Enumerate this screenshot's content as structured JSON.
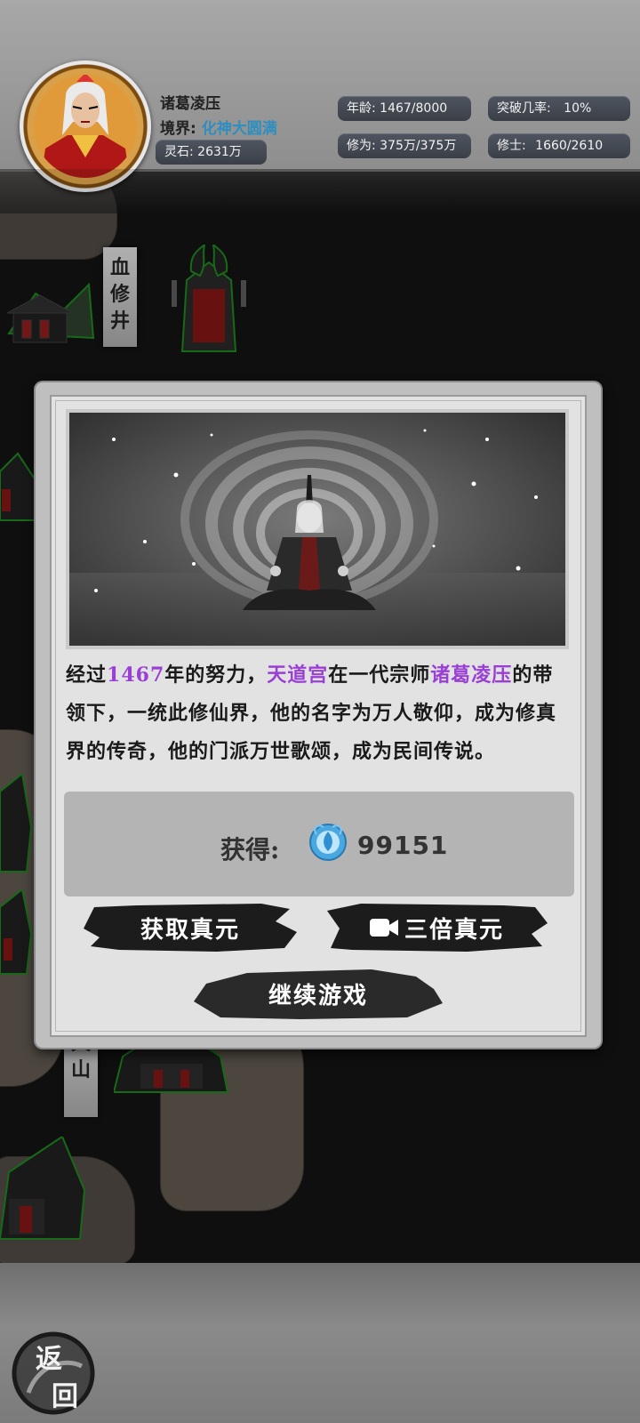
{
  "hud": {
    "name": "诸葛凌压",
    "realm_label": "境界:",
    "realm_value": "化神大圆满",
    "spirit_stones_label": "灵石:",
    "spirit_stones_value": "2631万",
    "age_label": "年龄:",
    "age_value": "1467/8000",
    "breakthrough_label": "突破几率:",
    "breakthrough_value": "10%",
    "cultivation_label": "修为:",
    "cultivation_value": "375万/375万",
    "disciples_label": "修士:",
    "disciples_value": "1660/2610"
  },
  "map": {
    "place1": "血修井",
    "place2": "天山"
  },
  "modal": {
    "story": [
      {
        "t": "经过",
        "hl": false
      },
      {
        "t": "1467",
        "hl": true
      },
      {
        "t": "年的努力，",
        "hl": false
      },
      {
        "t": "天道宫",
        "hl": true
      },
      {
        "t": "在一代宗师",
        "hl": false
      },
      {
        "t": "诸葛凌压",
        "hl": true
      },
      {
        "t": "的带领下，一统此修仙界，他的名字为万人敬仰，成为修真界的传奇，他的门派万世歌颂，成为民间传说。",
        "hl": false
      }
    ],
    "reward_label": "获得:",
    "reward_value": "99151",
    "reward_icon": "true-essence-orb-icon",
    "btn_get": "获取真元",
    "btn_triple": "三倍真元",
    "btn_triple_icon": "video-camera-icon",
    "btn_continue": "继续游戏"
  },
  "back": {
    "label_top": "返",
    "label_bottom": "回"
  },
  "colors": {
    "highlight": "#9a3fd6",
    "realm": "#2e8ec0"
  }
}
